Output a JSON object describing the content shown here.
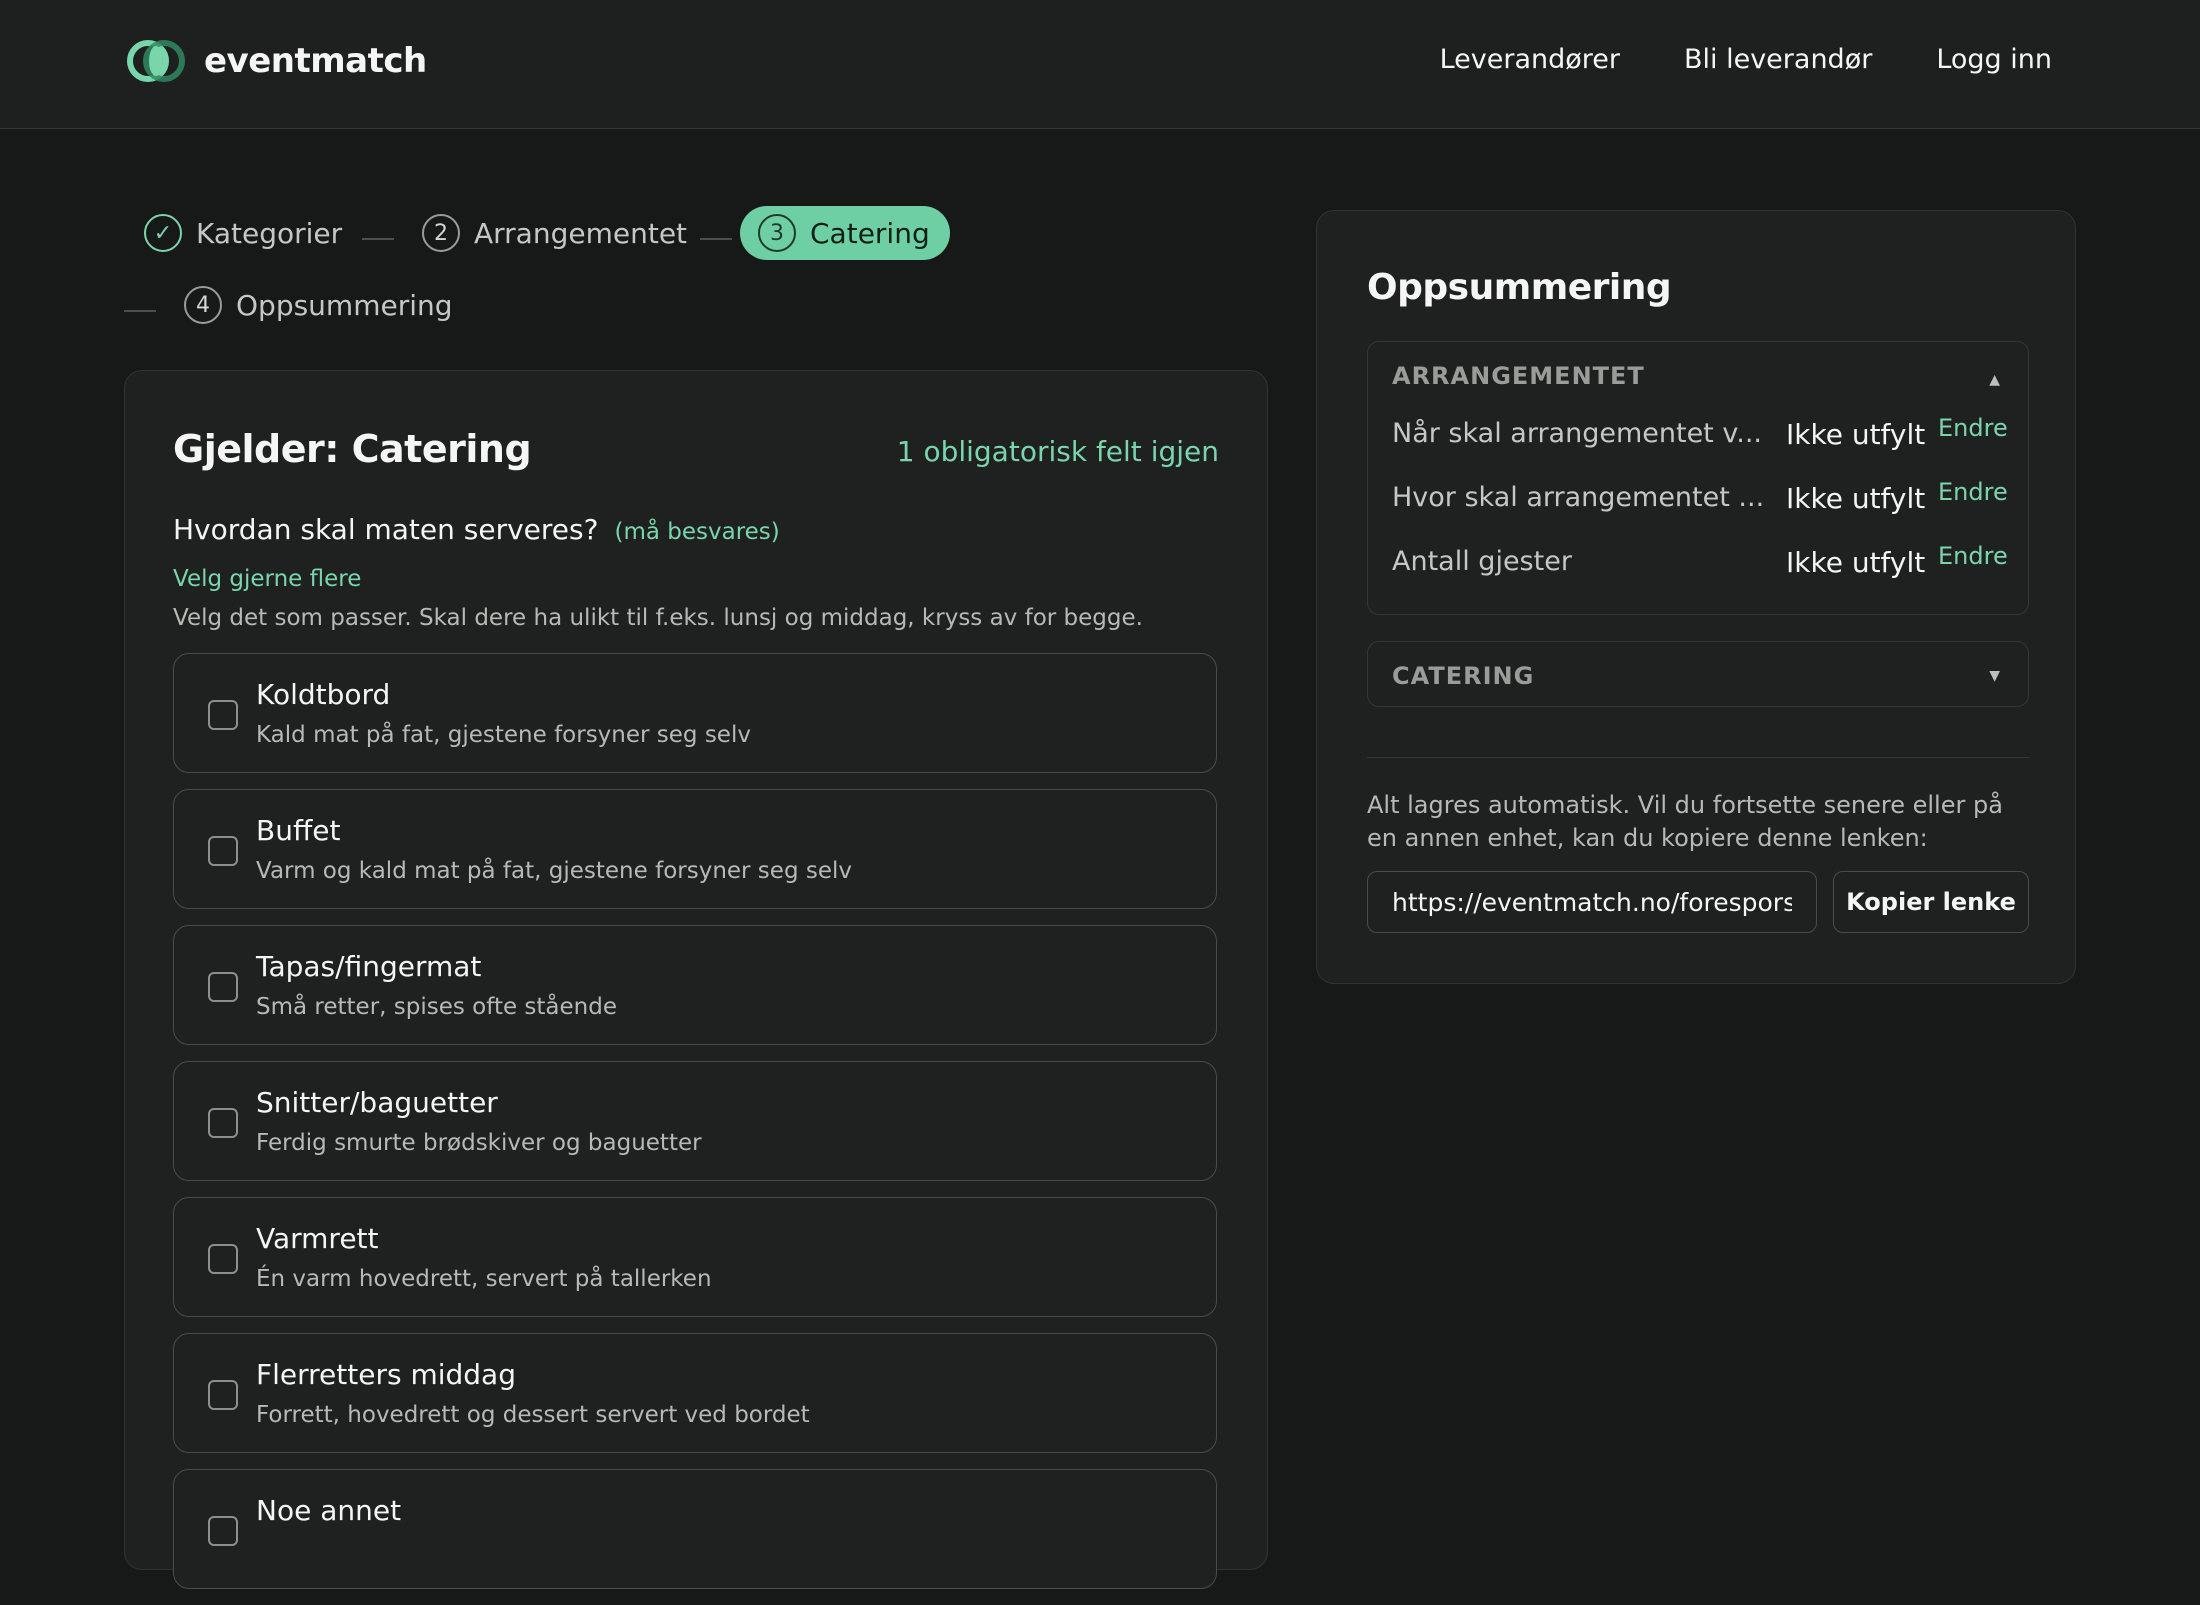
{
  "header": {
    "brand": "eventmatch",
    "nav": [
      "Leverandører",
      "Bli leverandør",
      "Logg inn"
    ]
  },
  "stepper": {
    "steps": [
      {
        "index": "✓",
        "label": "Kategorier",
        "state": "done"
      },
      {
        "index": "2",
        "label": "Arrangementet",
        "state": "upcoming"
      },
      {
        "index": "3",
        "label": "Catering",
        "state": "active"
      },
      {
        "index": "4",
        "label": "Oppsummering",
        "state": "upcoming"
      }
    ]
  },
  "form": {
    "title": "Gjelder: Catering",
    "remaining": "1 obligatorisk felt igjen",
    "question": "Hvordan skal maten serveres?",
    "required": "(må besvares)",
    "hint_multi": "Velg gjerne flere",
    "hint_desc": "Velg det som passer. Skal dere ha ulikt til f.eks. lunsj og middag, kryss av for begge.",
    "options": [
      {
        "title": "Koldtbord",
        "desc": "Kald mat på fat, gjestene forsyner seg selv",
        "checked": false
      },
      {
        "title": "Buffet",
        "desc": "Varm og kald mat på fat, gjestene forsyner seg selv",
        "checked": false
      },
      {
        "title": "Tapas/fingermat",
        "desc": "Små retter, spises ofte stående",
        "checked": false
      },
      {
        "title": "Snitter/baguetter",
        "desc": "Ferdig smurte brødskiver og baguetter",
        "checked": false
      },
      {
        "title": "Varmrett",
        "desc": "Én varm hovedrett, servert på tallerken",
        "checked": false
      },
      {
        "title": "Flerretters middag",
        "desc": "Forrett, hovedrett og dessert servert ved bordet",
        "checked": false
      },
      {
        "title": "Noe annet",
        "desc": "",
        "checked": false
      }
    ]
  },
  "summary": {
    "title": "Oppsummering",
    "sections": [
      {
        "heading": "ARRANGEMENTET",
        "expanded": true,
        "rows": [
          {
            "label": "Når skal arrangementet v...",
            "value": "Ikke utfylt",
            "action": "Endre"
          },
          {
            "label": "Hvor skal arrangementet ...",
            "value": "Ikke utfylt",
            "action": "Endre"
          },
          {
            "label": "Antall gjester",
            "value": "Ikke utfylt",
            "action": "Endre"
          }
        ]
      },
      {
        "heading": "CATERING",
        "expanded": false,
        "rows": []
      }
    ],
    "autosave_text": "Alt lagres automatisk. Vil du fortsette senere eller på en annen enhet, kan du kopiere denne lenken:",
    "link_value": "https://eventmatch.no/forespors...",
    "copy_button": "Kopier lenke"
  },
  "colors": {
    "accent": "#79d5ab",
    "active_step_bg": "#6fcfa4",
    "background": "#171818",
    "card": "#1f2020"
  },
  "icons": {
    "logo": "overlapping-circles-logo",
    "done_step": "checkmark-icon",
    "caret_up": "caret-up-icon",
    "caret_down": "caret-down-icon"
  }
}
